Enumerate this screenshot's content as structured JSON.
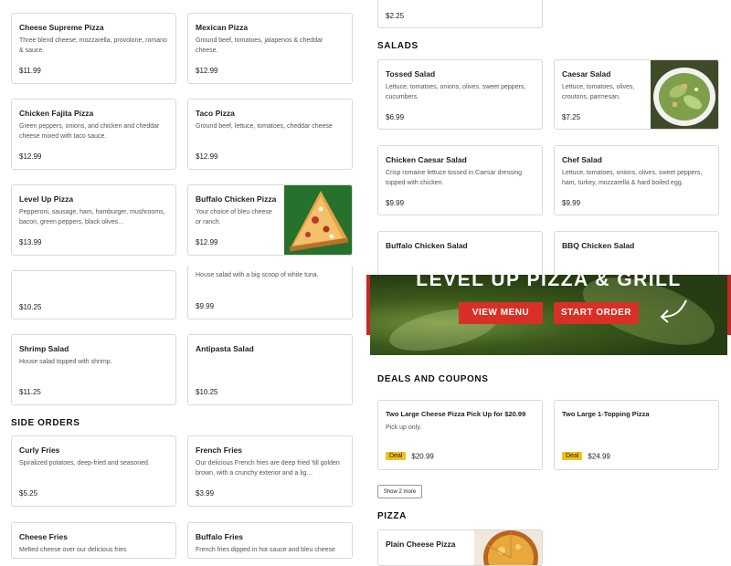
{
  "left_menu": {
    "items": [
      {
        "name": "Cheese Supreme Pizza",
        "desc": "Three blend cheese; mozzarella, provolone, romano & sauce.",
        "price": "$11.99"
      },
      {
        "name": "Mexican Pizza",
        "desc": "Ground beef, tomatoes, jalapenos & cheddar cheese.",
        "price": "$12.99"
      },
      {
        "name": "Chicken Fajita Pizza",
        "desc": "Green peppers, onions, and chicken and cheddar cheese mixed with taco sauce.",
        "price": "$12.99"
      },
      {
        "name": "Taco Pizza",
        "desc": "Ground beef, lettuce, tomatoes, cheddar cheese",
        "price": "$12.99"
      },
      {
        "name": "Level Up Pizza",
        "desc": "Pepperoni, sausage, ham, hamburger, mushrooms, bacon, green peppers, black olives…",
        "price": "$13.99"
      },
      {
        "name": "Buffalo Chicken Pizza",
        "desc": "Your choice of bleu cheese or ranch.",
        "price": "$12.99"
      },
      {
        "name": "",
        "desc": "",
        "price": "$10.25"
      },
      {
        "name": "",
        "desc": "House salad with a big scoop of white tuna.",
        "price": "$9.99"
      },
      {
        "name": "Shrimp Salad",
        "desc": "House salad topped with shrimp.",
        "price": "$11.25"
      },
      {
        "name": "Antipasta Salad",
        "desc": "",
        "price": "$10.25"
      }
    ],
    "side_orders_title": "SIDE ORDERS",
    "sides": [
      {
        "name": "Curly Fries",
        "desc": "Spiralized potatoes, deep-fried and seasoned.",
        "price": "$5.25"
      },
      {
        "name": "French Fries",
        "desc": "Our delicious French fries are deep fried 'till golden brown, with a crunchy exterior and a lig…",
        "price": "$3.99"
      },
      {
        "name": "Cheese Fries",
        "desc": "Melted cheese over our delicious fries",
        "price": ""
      },
      {
        "name": "Buffalo Fries",
        "desc": "French fries dipped in hot sauce and bleu cheese",
        "price": ""
      }
    ]
  },
  "right_menu": {
    "top_price": "$2.25",
    "salads_title": "SALADS",
    "salads": [
      {
        "name": "Tossed Salad",
        "desc": "Lettuce, tomatoes, onions, olives, sweet peppers, cucumbers.",
        "price": "$6.99"
      },
      {
        "name": "Caesar Salad",
        "desc": "Lettuce, tomatoes, olives, croutons, parmesan.",
        "price": "$7.25"
      },
      {
        "name": "Chicken Caesar Salad",
        "desc": "Crisp romaine lettuce tossed in Caesar dressing topped with chicken.",
        "price": "$9.99"
      },
      {
        "name": "Chef Salad",
        "desc": "Lettuce, tomatoes, onions, olives, sweet peppers, ham, turkey, mozzarella & hard boiled egg.",
        "price": "$9.99"
      },
      {
        "name": "Buffalo Chicken Salad",
        "desc": "",
        "price": ""
      },
      {
        "name": "BBQ Chicken Salad",
        "desc": "",
        "price": ""
      }
    ],
    "banner": {
      "heading": "LEVEL UP PIZZA & GRILL",
      "view_menu": "VIEW MENU",
      "start_order": "START ORDER"
    },
    "deals_title": "DEALS AND COUPONS",
    "deals": [
      {
        "name": "Two Large Cheese Pizza Pick Up for $20.99",
        "desc": "Pick up only.",
        "badge": "Deal",
        "price": "$20.99"
      },
      {
        "name": "Two Large 1-Topping Pizza",
        "desc": "",
        "badge": "Deal",
        "price": "$24.99"
      }
    ],
    "show_more": "Show 2 more",
    "pizza_title": "PIZZA",
    "pizza_first": {
      "name": "Plain Cheese Pizza"
    }
  },
  "colors": {
    "accent": "#d93025",
    "deal_badge": "#f1c21b",
    "border": "#d9d9d9"
  }
}
